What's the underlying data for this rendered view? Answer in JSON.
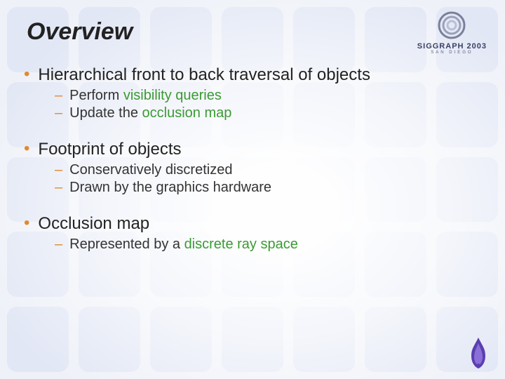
{
  "title": "Overview",
  "logo": {
    "org": "SIGGRAPH 2003",
    "city": "SAN DIEGO"
  },
  "bullets": [
    {
      "text": "Hierarchical front to back traversal of objects",
      "subs": [
        {
          "pre": "Perform ",
          "hl": "visibility queries",
          "post": ""
        },
        {
          "pre": "Update the ",
          "hl": "occlusion map",
          "post": ""
        }
      ]
    },
    {
      "text": "Footprint of objects",
      "subs": [
        {
          "pre": "Conservatively discretized",
          "hl": "",
          "post": ""
        },
        {
          "pre": "Drawn by the graphics hardware",
          "hl": "",
          "post": ""
        }
      ]
    },
    {
      "text": "Occlusion map",
      "subs": [
        {
          "pre": "Represented by a ",
          "hl": "discrete ray space",
          "post": ""
        }
      ]
    }
  ]
}
